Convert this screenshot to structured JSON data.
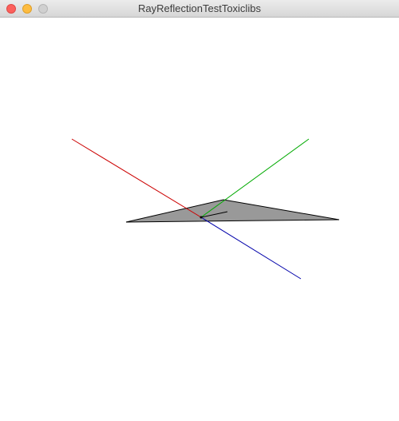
{
  "window": {
    "title": "RayReflectionTestToxiclibs",
    "controls": [
      "close-icon",
      "minimize-icon",
      "maximize-icon"
    ]
  },
  "scene": {
    "background": "#ffffff",
    "plane_fill": "#999999",
    "plane_stroke": "#000000",
    "incident_ray_color": "#cc0000",
    "reflected_ray_color": "#00aa00",
    "transmitted_ray_color": "#0000aa",
    "normal_color": "#000000"
  }
}
